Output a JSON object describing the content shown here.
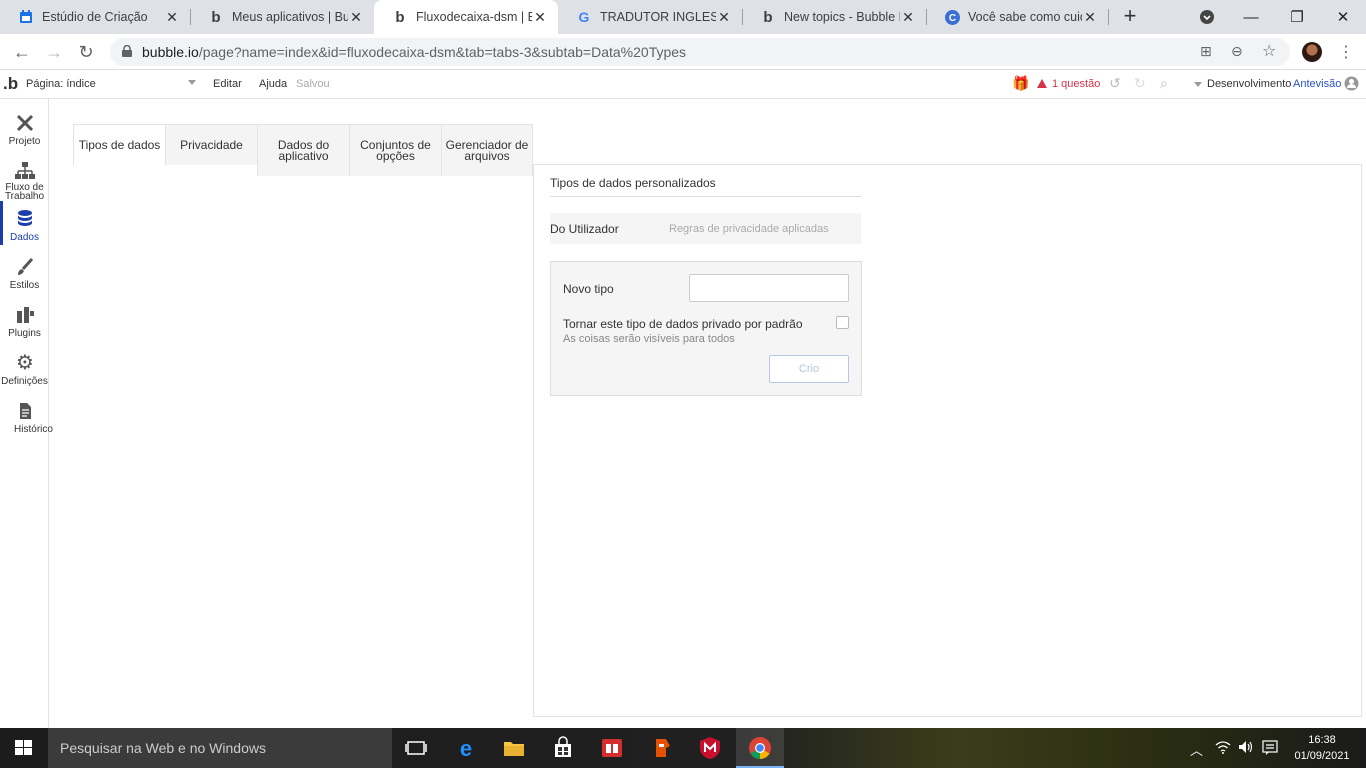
{
  "browser": {
    "tabs": [
      {
        "title": "Estúdio de Criação",
        "favicon": "calendar-blue-icon"
      },
      {
        "title": "Meus aplicativos | Bubble",
        "favicon": "bubble-b-icon"
      },
      {
        "title": "Fluxodecaixa-dsm | Editor",
        "favicon": "bubble-b-icon"
      },
      {
        "title": "TRADUTOR INGLES - Pesquisa",
        "favicon": "google-g-icon"
      },
      {
        "title": "New topics - Bubble Forum",
        "favicon": "bubble-b-icon"
      },
      {
        "title": "Você sabe como cuidar",
        "favicon": "c-circle-icon"
      }
    ],
    "url_host": "bubble.io",
    "url_path": "/page?name=index&id=fluxodecaixa-dsm&tab=tabs-3&subtab=Data%20Types"
  },
  "bubble_bar": {
    "logo": ".b",
    "page_label": "Página: índice",
    "menu_edit": "Editar",
    "menu_help": "Ajuda",
    "saved": "Salvou",
    "issues": "1 questão",
    "mode": "Desenvolvimento",
    "preview": "Antevisão"
  },
  "sidebar": {
    "items": [
      {
        "label": "Projeto",
        "icon": "tools-icon"
      },
      {
        "label": "Fluxo de Trabalho",
        "icon": "workflow-icon"
      },
      {
        "label": "Dados",
        "icon": "database-icon"
      },
      {
        "label": "Estilos",
        "icon": "brush-icon"
      },
      {
        "label": "Plugins",
        "icon": "plugin-icon"
      },
      {
        "label": "Definições",
        "icon": "gear-icon"
      },
      {
        "label": "Histórico",
        "icon": "document-icon"
      }
    ]
  },
  "data_tabs": [
    {
      "label": "Tipos de dados"
    },
    {
      "label": "Privacidade"
    },
    {
      "label": "Dados do aplicativo"
    },
    {
      "label": "Conjuntos de opções"
    },
    {
      "label": "Gerenciador de arquivos"
    }
  ],
  "data_types": {
    "section_title": "Tipos de dados personalizados",
    "type_name": "Do Utilizador",
    "type_privacy": "Regras de privacidade aplicadas",
    "new_type_label": "Novo tipo",
    "new_type_value": "",
    "private_label": "Tornar este tipo de dados privado por padrão",
    "private_sub": "As coisas serão visíveis para todos",
    "create_button": "Crio"
  },
  "taskbar": {
    "search_placeholder": "Pesquisar na Web e no Windows",
    "time": "16:38",
    "date": "01/09/2021"
  }
}
